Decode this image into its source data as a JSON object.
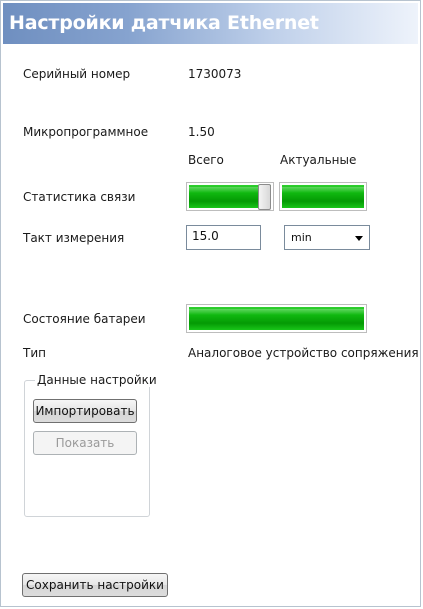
{
  "title": "Настройки датчика Ethernet",
  "serial": {
    "label": "Серийный номер",
    "value": "1730073"
  },
  "firmware": {
    "label": "Микропрограммное",
    "value": "1.50"
  },
  "columns": {
    "total": "Всего",
    "actual": "Актуальные"
  },
  "link_stats": {
    "label": "Статистика связи",
    "total_level": 1.0,
    "actual_level": 1.0
  },
  "measurement": {
    "label": "Такт измерения",
    "value": "15.0",
    "unit": "min"
  },
  "battery": {
    "label": "Состояние батареи",
    "level": 1.0
  },
  "type": {
    "label": "Тип",
    "value": "Аналоговое устройство сопряжения"
  },
  "settings_data": {
    "group_label": "Данные настройки",
    "import_button": "Импортировать",
    "show_button": "Показать"
  },
  "save_button": "Сохранить настройки",
  "colors": {
    "title_bar_start": "#6f8fc0",
    "title_bar_end": "#eef3fb",
    "bar_green": "#10b810"
  }
}
